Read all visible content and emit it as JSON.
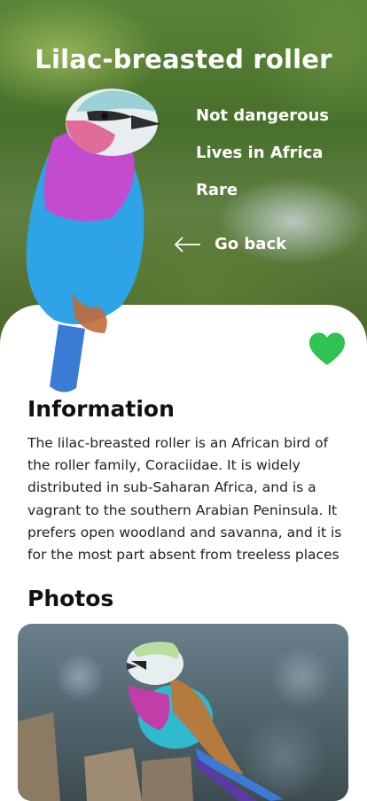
{
  "header": {
    "title": "Lilac-breasted roller",
    "facts": [
      "Not dangerous",
      "Lives in Africa",
      "Rare"
    ],
    "back_label": "Go back"
  },
  "info": {
    "title": "Information",
    "text": "The lilac-breasted roller is an African bird of the roller family, Coraciidae. It is widely distributed in sub-Saharan Africa, and is a vagrant to the southern Arabian Peninsula. It prefers open woodland and savanna, and it is for the most part absent from treeless places"
  },
  "photos": {
    "title": "Photos"
  },
  "colors": {
    "accent": "#2ec353",
    "text": "#111111"
  },
  "icons": {
    "back": "arrow-left-icon",
    "favorite": "heart-icon"
  }
}
